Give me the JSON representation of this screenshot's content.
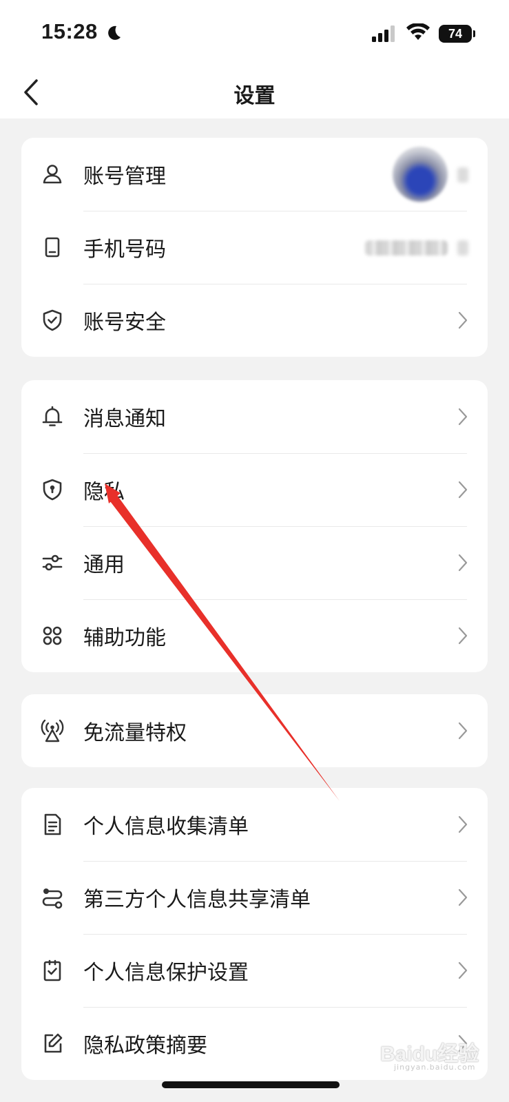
{
  "status": {
    "time": "15:28",
    "battery": "74"
  },
  "nav": {
    "title": "设置"
  },
  "groups": [
    {
      "items": [
        {
          "label": "账号管理",
          "icon": "person-icon"
        },
        {
          "label": "手机号码",
          "icon": "phone-icon"
        },
        {
          "label": "账号安全",
          "icon": "shield-check-icon"
        }
      ]
    },
    {
      "items": [
        {
          "label": "消息通知",
          "icon": "bell-icon"
        },
        {
          "label": "隐私",
          "icon": "privacy-shield-icon"
        },
        {
          "label": "通用",
          "icon": "sliders-icon"
        },
        {
          "label": "辅助功能",
          "icon": "grid-icon"
        }
      ]
    },
    {
      "items": [
        {
          "label": "免流量特权",
          "icon": "broadcast-icon"
        }
      ]
    },
    {
      "items": [
        {
          "label": "个人信息收集清单",
          "icon": "document-icon"
        },
        {
          "label": "第三方个人信息共享清单",
          "icon": "share-flow-icon"
        },
        {
          "label": "个人信息保护设置",
          "icon": "checklist-icon"
        },
        {
          "label": "隐私政策摘要",
          "icon": "edit-icon"
        }
      ]
    }
  ],
  "watermark": {
    "brand": "Baidu经验",
    "sub": "jingyan.baidu.com"
  },
  "colors": {
    "annotation_arrow": "#e8302a",
    "background": "#f2f2f2",
    "card": "#ffffff"
  }
}
